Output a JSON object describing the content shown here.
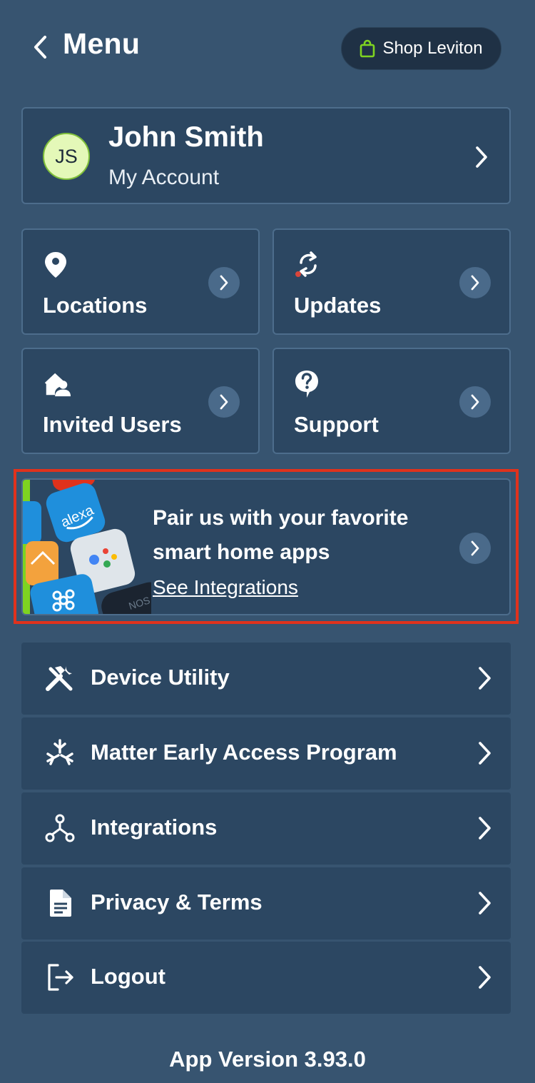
{
  "header": {
    "title": "Menu",
    "shop_label": "Shop Leviton",
    "shop_icon_color": "#7ed321"
  },
  "account": {
    "initials": "JS",
    "name": "John Smith",
    "subtitle": "My Account"
  },
  "tiles": [
    {
      "label": "Locations",
      "icon": "map-pin-icon"
    },
    {
      "label": "Updates",
      "icon": "refresh-icon"
    },
    {
      "label": "Invited Users",
      "icon": "house-user-icon"
    },
    {
      "label": "Support",
      "icon": "help-icon"
    }
  ],
  "promo": {
    "title": "Pair us with your favorite smart home apps",
    "link": "See Integrations",
    "art_alexa_text": "alexa",
    "accent_color": "#7ed321"
  },
  "list": [
    {
      "label": "Device Utility",
      "icon": "tools-icon"
    },
    {
      "label": "Matter Early Access Program",
      "icon": "matter-icon"
    },
    {
      "label": "Integrations",
      "icon": "integrations-icon"
    },
    {
      "label": "Privacy & Terms",
      "icon": "document-icon"
    },
    {
      "label": "Logout",
      "icon": "logout-icon"
    }
  ],
  "footer": {
    "version": "App Version 3.93.0"
  },
  "colors": {
    "background": "#375470",
    "card": "#2c4762",
    "card_border": "#4d6d8c",
    "highlight_outline": "#e0321c"
  }
}
